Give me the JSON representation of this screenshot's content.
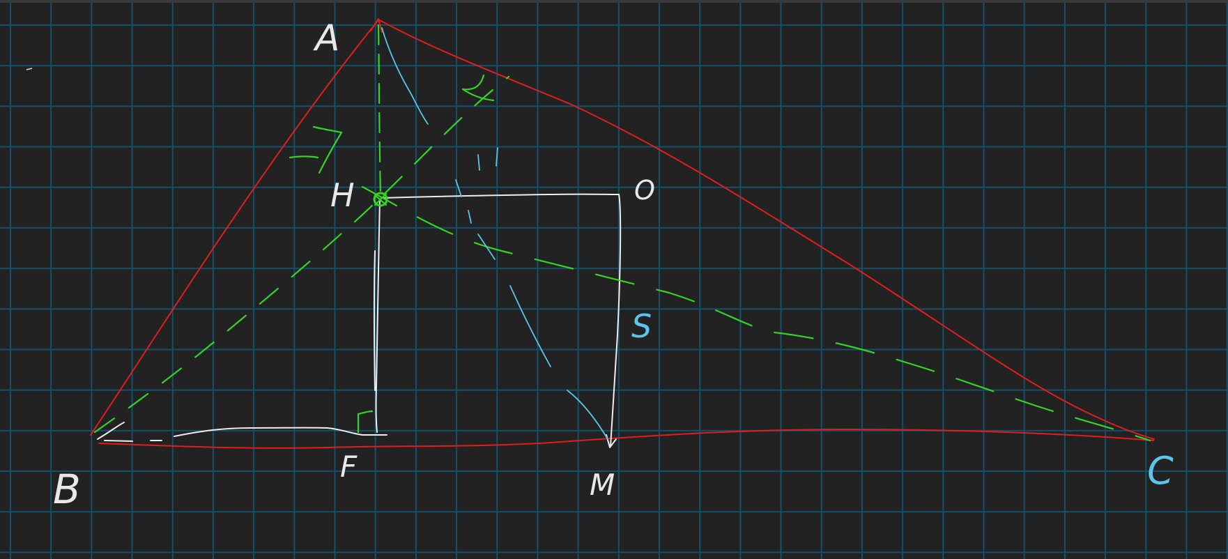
{
  "diagram": {
    "colors": {
      "background": "#222222",
      "grid": "#14506e",
      "triangle": "#e01e1e",
      "construction": "#eeeeee",
      "auxiliary": "#35d424",
      "annotation": "#5cc6ea"
    },
    "labels": {
      "A": "A",
      "B": "B",
      "C": "C",
      "H": "H",
      "O": "O",
      "F": "F",
      "M": "M",
      "S": "S"
    }
  }
}
